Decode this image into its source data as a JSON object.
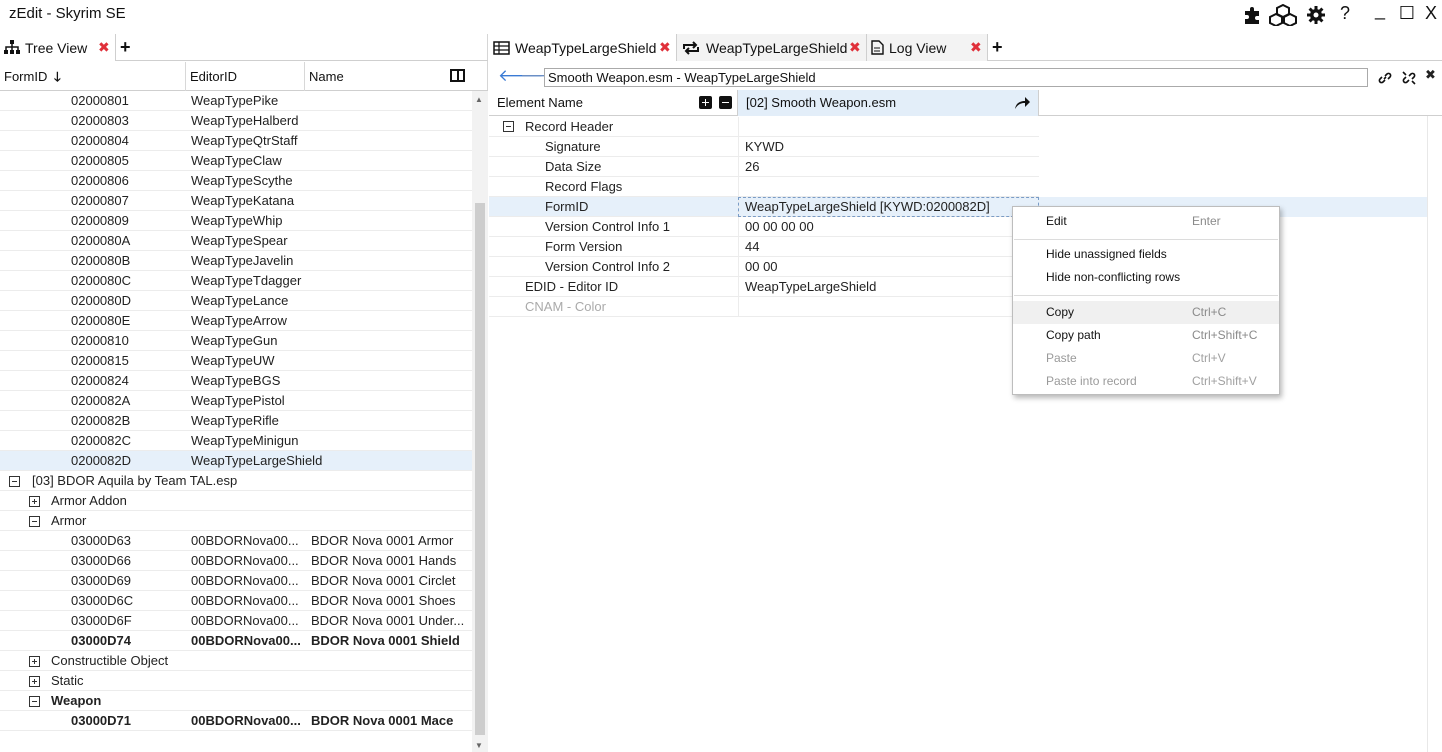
{
  "app": {
    "title": "zEdit - Skyrim SE",
    "icons": [
      "plugin-icon",
      "cubes-icon",
      "gear-icon",
      "help-icon"
    ],
    "help_label": "?",
    "minimize_label": "_",
    "maximize_label": "☐",
    "close_label": "X"
  },
  "left": {
    "tab": {
      "label": "Tree View",
      "close": "✖",
      "add": "+"
    },
    "columns": {
      "formid": "FormID",
      "editorid": "EditorID",
      "name": "Name"
    },
    "rows": [
      {
        "formid": "02000801",
        "editorid": "WeapTypePike",
        "name": ""
      },
      {
        "formid": "02000803",
        "editorid": "WeapTypeHalberd",
        "name": ""
      },
      {
        "formid": "02000804",
        "editorid": "WeapTypeQtrStaff",
        "name": ""
      },
      {
        "formid": "02000805",
        "editorid": "WeapTypeClaw",
        "name": ""
      },
      {
        "formid": "02000806",
        "editorid": "WeapTypeScythe",
        "name": ""
      },
      {
        "formid": "02000807",
        "editorid": "WeapTypeKatana",
        "name": ""
      },
      {
        "formid": "02000809",
        "editorid": "WeapTypeWhip",
        "name": ""
      },
      {
        "formid": "0200080A",
        "editorid": "WeapTypeSpear",
        "name": ""
      },
      {
        "formid": "0200080B",
        "editorid": "WeapTypeJavelin",
        "name": ""
      },
      {
        "formid": "0200080C",
        "editorid": "WeapTypeTdagger",
        "name": ""
      },
      {
        "formid": "0200080D",
        "editorid": "WeapTypeLance",
        "name": ""
      },
      {
        "formid": "0200080E",
        "editorid": "WeapTypeArrow",
        "name": ""
      },
      {
        "formid": "02000810",
        "editorid": "WeapTypeGun",
        "name": ""
      },
      {
        "formid": "02000815",
        "editorid": "WeapTypeUW",
        "name": ""
      },
      {
        "formid": "02000824",
        "editorid": "WeapTypeBGS",
        "name": ""
      },
      {
        "formid": "0200082A",
        "editorid": "WeapTypePistol",
        "name": ""
      },
      {
        "formid": "0200082B",
        "editorid": "WeapTypeRifle",
        "name": ""
      },
      {
        "formid": "0200082C",
        "editorid": "WeapTypeMinigun",
        "name": ""
      },
      {
        "formid": "0200082D",
        "editorid": "WeapTypeLargeShield",
        "name": ""
      }
    ],
    "plugin_node": "[03] BDOR Aquila by Team TAL.esp",
    "group_armor_addon": "Armor Addon",
    "group_armor": "Armor",
    "armor_rows": [
      {
        "formid": "03000D63",
        "editorid": "00BDORNova00...",
        "name": "BDOR Nova 0001 Armor"
      },
      {
        "formid": "03000D66",
        "editorid": "00BDORNova00...",
        "name": "BDOR Nova 0001 Hands"
      },
      {
        "formid": "03000D69",
        "editorid": "00BDORNova00...",
        "name": "BDOR Nova 0001 Circlet"
      },
      {
        "formid": "03000D6C",
        "editorid": "00BDORNova00...",
        "name": "BDOR Nova 0001 Shoes"
      },
      {
        "formid": "03000D6F",
        "editorid": "00BDORNova00...",
        "name": "BDOR Nova 0001 Under..."
      },
      {
        "formid": "03000D74",
        "editorid": "00BDORNova00...",
        "name": "BDOR Nova 0001 Shield"
      }
    ],
    "group_constructible": "Constructible Object",
    "group_static": "Static",
    "group_weapon": "Weapon",
    "weapon_rows": [
      {
        "formid": "03000D71",
        "editorid": "00BDORNova00...",
        "name": "BDOR Nova 0001 Mace"
      }
    ]
  },
  "right": {
    "tabs": [
      {
        "label": "WeapTypeLargeShield",
        "icon": "grid-icon"
      },
      {
        "label": "WeapTypeLargeShield",
        "icon": "repeat-icon"
      },
      {
        "label": "Log View",
        "icon": "document-icon"
      }
    ],
    "tab_close": "✖",
    "tab_add": "+",
    "path": "Smooth Weapon.esm - WeapTypeLargeShield",
    "header": {
      "element_name": "Element Name",
      "file": "[02] Smooth Weapon.esm"
    },
    "records": [
      {
        "name": "Record Header",
        "value": "",
        "indent": 1,
        "expander": "minus"
      },
      {
        "name": "Signature",
        "value": "KYWD",
        "indent": 2
      },
      {
        "name": "Data Size",
        "value": "26",
        "indent": 2
      },
      {
        "name": "Record Flags",
        "value": "",
        "indent": 2
      },
      {
        "name": "FormID",
        "value": "WeapTypeLargeShield [KYWD:0200082D]",
        "indent": 2,
        "highlight": true
      },
      {
        "name": "Version Control Info 1",
        "value": "00 00 00 00",
        "indent": 2
      },
      {
        "name": "Form Version",
        "value": "44",
        "indent": 2
      },
      {
        "name": "Version Control Info 2",
        "value": "00 00",
        "indent": 2
      },
      {
        "name": "EDID - Editor ID",
        "value": "WeapTypeLargeShield",
        "indent": 1
      },
      {
        "name": "CNAM - Color",
        "value": "",
        "indent": 1,
        "dim": true
      }
    ]
  },
  "context_menu": {
    "items": [
      {
        "label": "Edit",
        "shortcut": "Enter",
        "disabled": false
      },
      {
        "label": "Hide unassigned fields",
        "shortcut": "",
        "disabled": false
      },
      {
        "label": "Hide non-conflicting rows",
        "shortcut": "",
        "disabled": false
      },
      {
        "label": "Copy",
        "shortcut": "Ctrl+C",
        "disabled": false,
        "hover": true
      },
      {
        "label": "Copy path",
        "shortcut": "Ctrl+Shift+C",
        "disabled": false
      },
      {
        "label": "Paste",
        "shortcut": "Ctrl+V",
        "disabled": true
      },
      {
        "label": "Paste into record",
        "shortcut": "Ctrl+Shift+V",
        "disabled": true
      }
    ]
  },
  "colors": {
    "accent": "#3a7bd5",
    "close_x": "#e0303a",
    "selection": "#e6f0fa"
  }
}
